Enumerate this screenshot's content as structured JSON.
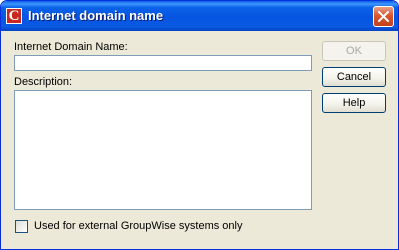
{
  "window": {
    "title": "Internet domain name"
  },
  "icons": {
    "app": "groupwise-c-icon",
    "close": "close-icon"
  },
  "colors": {
    "titlebar": "#0654e1",
    "close_button": "#d9572f",
    "face": "#ece9d8"
  },
  "form": {
    "domain_label": "Internet Domain Name:",
    "domain_value": "",
    "description_label": "Description:",
    "description_value": "",
    "external_checkbox_label": "Used for external GroupWise systems only",
    "external_checked": false
  },
  "buttons": {
    "ok": "OK",
    "cancel": "Cancel",
    "help": "Help"
  },
  "app_icon_letter": "C"
}
